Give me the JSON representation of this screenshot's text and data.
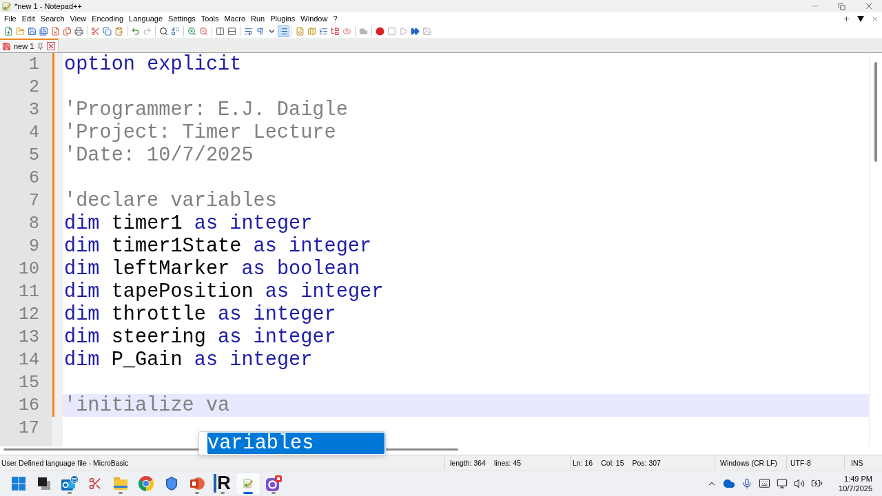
{
  "window": {
    "title": "*new 1 - Notepad++"
  },
  "menu": [
    "File",
    "Edit",
    "Search",
    "View",
    "Encoding",
    "Language",
    "Settings",
    "Tools",
    "Macro",
    "Run",
    "Plugins",
    "Window",
    "?"
  ],
  "toolbar": [
    {
      "on": false,
      "disabled": false
    },
    {
      "on": false,
      "disabled": false
    },
    {
      "on": false,
      "disabled": false
    },
    {
      "on": false,
      "disabled": false
    },
    {
      "on": false,
      "disabled": false
    },
    {
      "on": false,
      "disabled": false
    },
    {
      "on": false,
      "disabled": false
    },
    {
      "on": false,
      "disabled": false
    },
    {
      "on": false,
      "disabled": false
    },
    {
      "on": false,
      "disabled": false
    },
    {
      "on": false,
      "disabled": false
    },
    {
      "on": false,
      "disabled": true
    },
    {
      "on": false,
      "disabled": false
    },
    {
      "on": false,
      "disabled": false
    },
    {
      "on": false,
      "disabled": false
    },
    {
      "on": false,
      "disabled": false
    },
    {
      "on": false,
      "disabled": false
    },
    {
      "on": false,
      "disabled": false
    },
    {
      "on": false,
      "disabled": false
    },
    {
      "on": false,
      "disabled": false
    },
    {
      "on": false,
      "disabled": false
    },
    {
      "on": true,
      "disabled": false
    },
    {
      "on": false,
      "disabled": false
    },
    {
      "on": false,
      "disabled": false
    },
    {
      "on": false,
      "disabled": false
    },
    {
      "on": false,
      "disabled": false
    },
    {
      "on": false,
      "disabled": false
    },
    {
      "on": false,
      "disabled": true
    },
    {
      "on": false,
      "disabled": false
    },
    {
      "on": false,
      "disabled": true
    },
    {
      "on": false,
      "disabled": true
    },
    {
      "on": false,
      "disabled": false
    },
    {
      "on": false,
      "disabled": true
    }
  ],
  "tabs": [
    {
      "label": "new 1",
      "selected": true,
      "modified": true
    }
  ],
  "editor": {
    "lines": [
      {
        "number": "1",
        "modified": true,
        "current": false,
        "tokens": [
          {
            "kind": "keyword",
            "text": "option"
          },
          {
            "kind": "keyword",
            "text": "explicit"
          }
        ]
      },
      {
        "number": "2",
        "modified": true,
        "current": false
      },
      {
        "number": "3",
        "modified": true,
        "current": false,
        "tokens": [
          {
            "kind": "comment",
            "text": "'Programmer: E.J. Daigle"
          }
        ]
      },
      {
        "number": "4",
        "modified": true,
        "current": false,
        "tokens": [
          {
            "kind": "comment",
            "text": "'Project: Timer Lecture"
          }
        ]
      },
      {
        "number": "5",
        "modified": true,
        "current": false,
        "tokens": [
          {
            "kind": "comment",
            "text": "'Date: 10/7/2025"
          }
        ]
      },
      {
        "number": "6",
        "modified": true,
        "current": false
      },
      {
        "number": "7",
        "modified": true,
        "current": false,
        "tokens": [
          {
            "kind": "comment",
            "text": "'declare variables"
          }
        ]
      },
      {
        "number": "8",
        "modified": true,
        "current": false,
        "tokens": [
          {
            "kind": "keyword",
            "text": "dim"
          },
          {
            "kind": "identifier",
            "text": "timer1"
          },
          {
            "kind": "keyword",
            "text": "as"
          },
          {
            "kind": "keyword",
            "text": "integer"
          }
        ]
      },
      {
        "number": "9",
        "modified": true,
        "current": false,
        "tokens": [
          {
            "kind": "keyword",
            "text": "dim"
          },
          {
            "kind": "identifier",
            "text": "timer1State"
          },
          {
            "kind": "keyword",
            "text": "as"
          },
          {
            "kind": "keyword",
            "text": "integer"
          }
        ]
      },
      {
        "number": "10",
        "modified": true,
        "current": false,
        "tokens": [
          {
            "kind": "keyword",
            "text": "dim"
          },
          {
            "kind": "identifier",
            "text": "leftMarker"
          },
          {
            "kind": "keyword",
            "text": "as"
          },
          {
            "kind": "keyword",
            "text": "boolean"
          }
        ]
      },
      {
        "number": "11",
        "modified": true,
        "current": false,
        "tokens": [
          {
            "kind": "keyword",
            "text": "dim"
          },
          {
            "kind": "identifier",
            "text": "tapePosition"
          },
          {
            "kind": "keyword",
            "text": "as"
          },
          {
            "kind": "keyword",
            "text": "integer"
          }
        ]
      },
      {
        "number": "12",
        "modified": true,
        "current": false,
        "tokens": [
          {
            "kind": "keyword",
            "text": "dim"
          },
          {
            "kind": "identifier",
            "text": "throttle"
          },
          {
            "kind": "keyword",
            "text": "as"
          },
          {
            "kind": "keyword",
            "text": "integer"
          }
        ]
      },
      {
        "number": "13",
        "modified": true,
        "current": false,
        "tokens": [
          {
            "kind": "keyword",
            "text": "dim"
          },
          {
            "kind": "identifier",
            "text": "steering"
          },
          {
            "kind": "keyword",
            "text": "as"
          },
          {
            "kind": "keyword",
            "text": "integer"
          }
        ]
      },
      {
        "number": "14",
        "modified": true,
        "current": false,
        "tokens": [
          {
            "kind": "keyword",
            "text": "dim"
          },
          {
            "kind": "identifier",
            "text": "P_Gain"
          },
          {
            "kind": "keyword",
            "text": "as"
          },
          {
            "kind": "keyword",
            "text": "integer"
          }
        ]
      },
      {
        "number": "15",
        "modified": true,
        "current": false
      },
      {
        "number": "16",
        "modified": true,
        "current": true,
        "tokens": [
          {
            "kind": "comment",
            "text": "'initialize va"
          }
        ]
      },
      {
        "number": "17",
        "modified": false,
        "current": false
      }
    ],
    "autocomplete": [
      {
        "text": "variables",
        "selected": true
      }
    ]
  },
  "status_bar": {
    "language": "User Defined language file - MicroBasic",
    "length": "length: 364",
    "lines": "lines: 45",
    "line": "Ln: 16",
    "column": "Col: 15",
    "position": "Pos: 307",
    "eol": "Windows (CR LF)",
    "encoding": "UTF-8",
    "mode": "INS"
  },
  "taskbar": {
    "apps": [
      {
        "kind": "icon",
        "running": true,
        "active": false
      },
      {
        "kind": "icon",
        "running": false,
        "active": false
      },
      {
        "kind": "icon",
        "running": true,
        "active": false
      },
      {
        "kind": "icon",
        "running": false,
        "active": false
      },
      {
        "kind": "icon",
        "running": false,
        "active": false
      },
      {
        "kind": "icon",
        "running": true,
        "active": false
      },
      {
        "kind": "lettermark",
        "label": "R",
        "running": true,
        "active": false
      },
      {
        "kind": "icon",
        "running": true,
        "active": true
      },
      {
        "kind": "icon",
        "running": true,
        "active": false
      }
    ],
    "clock": {
      "time": "1:49 PM",
      "date": "10/7/2025"
    }
  }
}
